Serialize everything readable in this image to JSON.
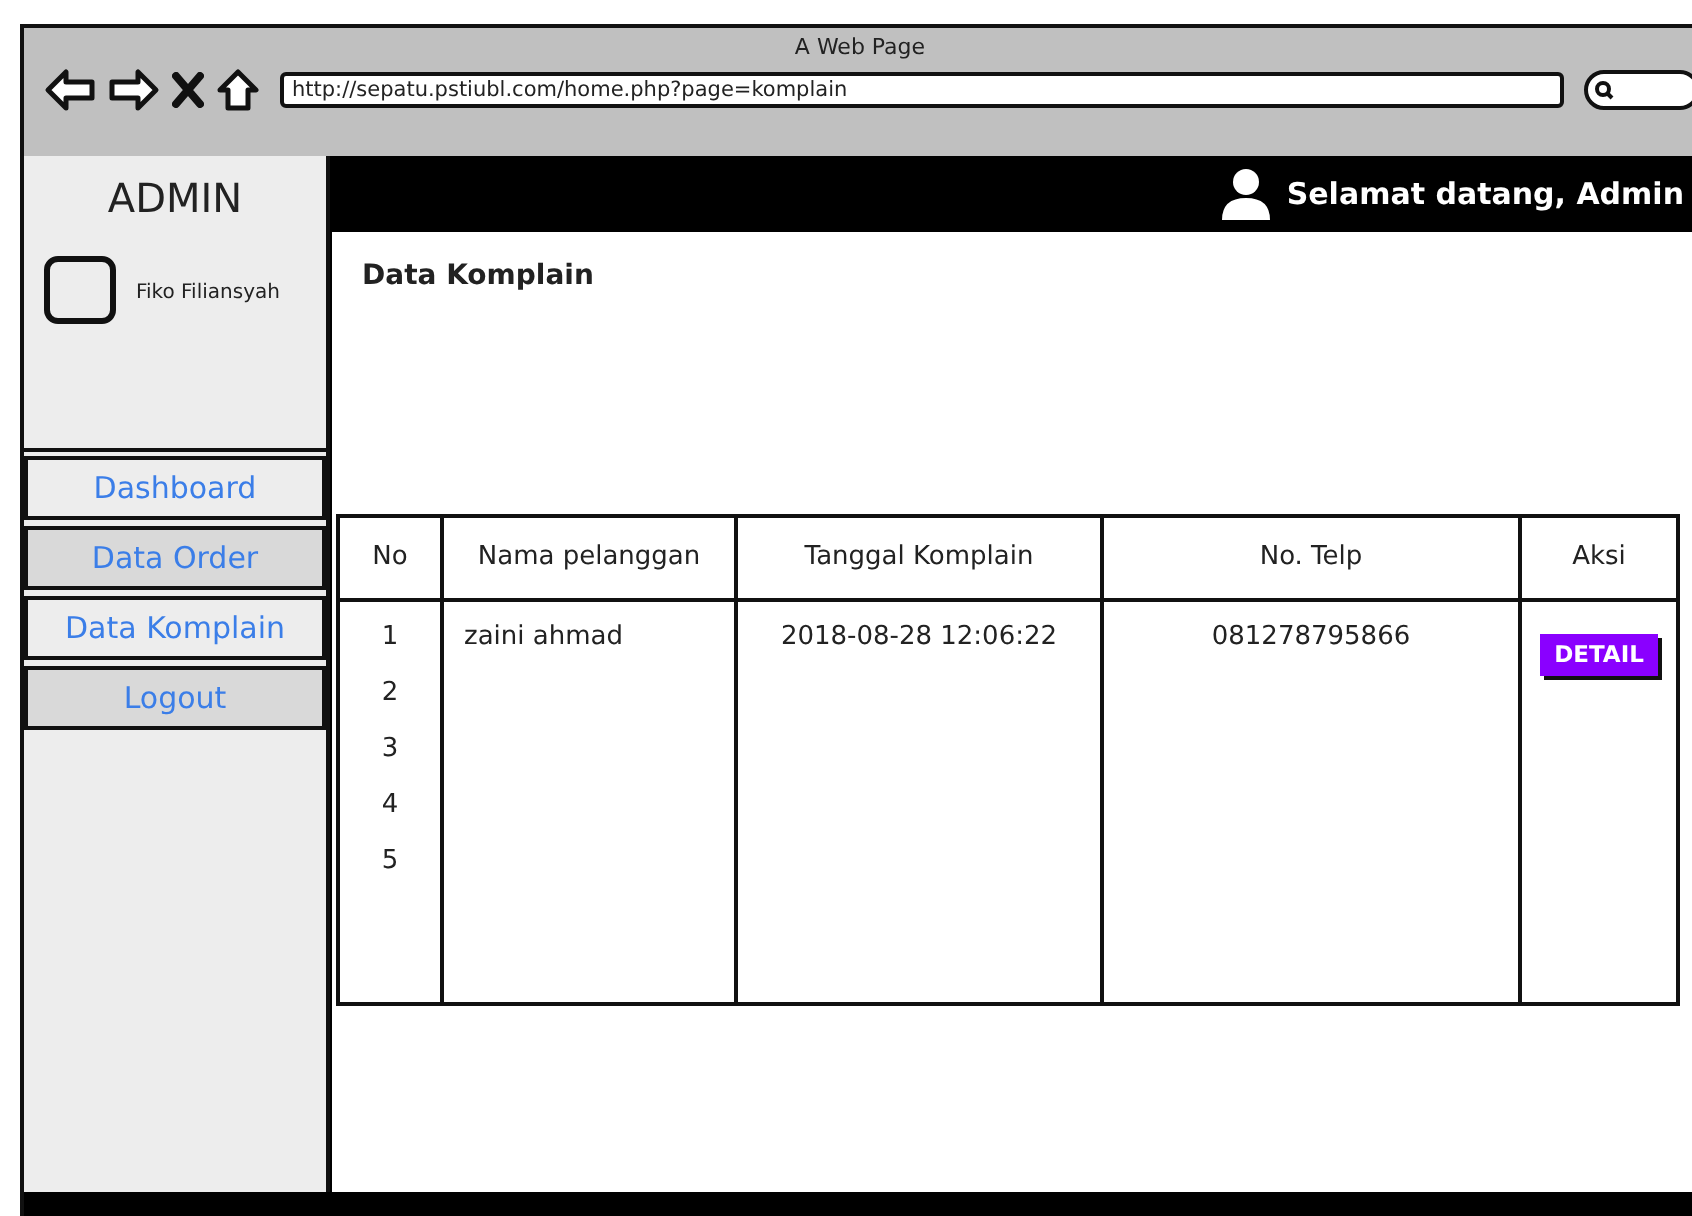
{
  "window": {
    "title": "A Web Page",
    "url": "http://sepatu.pstiubl.com/home.php?page=komplain"
  },
  "sidebar": {
    "title": "ADMIN",
    "user": "Fiko Filiansyah",
    "items": [
      {
        "label": "Dashboard",
        "shaded": false
      },
      {
        "label": "Data Order",
        "shaded": true
      },
      {
        "label": "Data Komplain",
        "shaded": false
      },
      {
        "label": "Logout",
        "shaded": true
      }
    ]
  },
  "header": {
    "greeting": "Selamat datang, Admin"
  },
  "page_title": "Data Komplain",
  "table": {
    "columns": [
      "No",
      "Nama pelanggan",
      "Tanggal Komplain",
      "No. Telp",
      "Aksi"
    ],
    "rows": [
      {
        "no": "1",
        "nama": "zaini ahmad",
        "tanggal": "2018-08-28 12:06:22",
        "telp": "081278795866",
        "action": "DETAIL"
      },
      {
        "no": "2"
      },
      {
        "no": "3"
      },
      {
        "no": "4"
      },
      {
        "no": "5"
      }
    ]
  }
}
